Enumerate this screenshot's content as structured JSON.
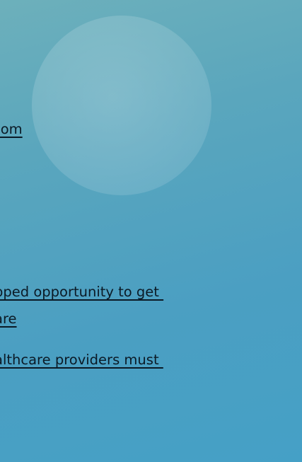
{
  "links": [
    {
      "text": "com"
    },
    {
      "text": "pped opportunity to get "
    },
    {
      "text": "are"
    },
    {
      "text": "althcare providers must "
    }
  ]
}
